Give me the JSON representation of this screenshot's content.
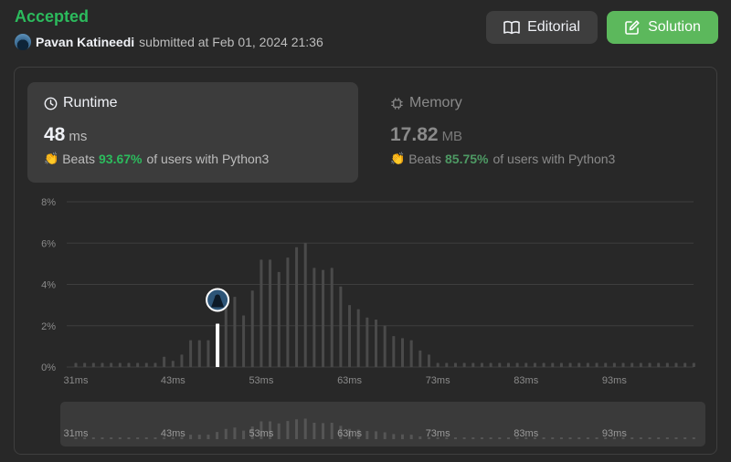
{
  "header": {
    "status": "Accepted",
    "user": "Pavan Katineedi",
    "submitted_text": "submitted at Feb 01, 2024 21:36"
  },
  "buttons": {
    "editorial": "Editorial",
    "solution": "Solution"
  },
  "runtime": {
    "title": "Runtime",
    "value": "48",
    "unit": "ms",
    "beats_label": "Beats",
    "percent": "93.67%",
    "suffix": "of users with Python3"
  },
  "memory": {
    "title": "Memory",
    "value": "17.82",
    "unit": "MB",
    "beats_label": "Beats",
    "percent": "85.75%",
    "suffix": "of users with Python3"
  },
  "colors": {
    "accent_green": "#2cbb5d",
    "bar": "#4a4a4a",
    "grid": "#3e3e3e"
  },
  "chart_data": {
    "type": "bar",
    "xlabel": "",
    "ylabel": "",
    "ylim": [
      0,
      8
    ],
    "y_ticks": [
      "0%",
      "2%",
      "4%",
      "6%",
      "8%"
    ],
    "x_tick_labels": [
      "31ms",
      "43ms",
      "53ms",
      "63ms",
      "73ms",
      "83ms",
      "93ms"
    ],
    "x_tick_bar_index": [
      0,
      11,
      21,
      31,
      41,
      51,
      61
    ],
    "highlight_index": 16,
    "values": [
      0.2,
      0.2,
      0.2,
      0.2,
      0.2,
      0.2,
      0.2,
      0.2,
      0.2,
      0.2,
      0.5,
      0.3,
      0.6,
      1.3,
      1.3,
      1.3,
      2.1,
      3.0,
      3.4,
      2.5,
      3.7,
      5.2,
      5.2,
      4.6,
      5.3,
      5.8,
      6.0,
      4.8,
      4.7,
      4.8,
      3.9,
      3.0,
      2.8,
      2.4,
      2.3,
      2.0,
      1.5,
      1.4,
      1.3,
      0.8,
      0.6,
      0.2,
      0.2,
      0.2,
      0.2,
      0.2,
      0.2,
      0.2,
      0.2,
      0.2,
      0.2,
      0.2,
      0.2,
      0.2,
      0.2,
      0.2,
      0.2,
      0.2,
      0.2,
      0.2,
      0.2,
      0.2,
      0.2,
      0.2,
      0.2,
      0.2,
      0.2,
      0.2,
      0.2,
      0.2,
      0.2
    ]
  }
}
